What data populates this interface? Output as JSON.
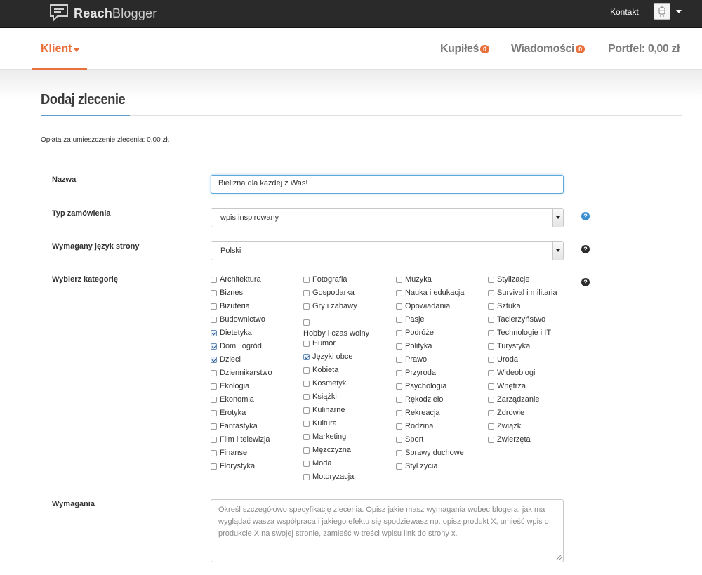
{
  "header": {
    "brand_bold": "Reach",
    "brand_light": "Blogger",
    "contact": "Kontakt"
  },
  "subnav": {
    "role": "Klient",
    "bought_label": "Kupiłeś",
    "bought_count": "0",
    "messages_label": "Wiadomości",
    "messages_count": "0",
    "wallet": "Portfel: 0,00 zł"
  },
  "page": {
    "title": "Dodaj zlecenie",
    "fee": "Opłata za umieszczenie zlecenia: 0,00 zł."
  },
  "form": {
    "name_label": "Nazwa",
    "name_value": "Bielizna dla każdej z Was!",
    "order_type_label": "Typ zamówienia",
    "order_type_value": "wpis inspirowany",
    "language_label": "Wymagany język strony",
    "language_value": "Polski",
    "category_label": "Wybierz kategorię",
    "requirements_label": "Wymagania",
    "requirements_placeholder": "Określ szczegółowo specyfikację zlecenia. Opisz jakie masz wymagania wobec blogera, jak ma wyglądać wasza współpraca i jakiego efektu się spodziewasz np. opisz produkt X, umieść wpis o produkcie X na swojej stronie, zamieść w treści wpisu link do strony x.",
    "help_glyph": "?"
  },
  "categories": [
    [
      {
        "label": "Architektura",
        "checked": false
      },
      {
        "label": "Biznes",
        "checked": false
      },
      {
        "label": "Biżuteria",
        "checked": false
      },
      {
        "label": "Budownictwo",
        "checked": false
      },
      {
        "label": "Dietetyka",
        "checked": true
      },
      {
        "label": "Dom i ogród",
        "checked": true
      },
      {
        "label": "Dzieci",
        "checked": true
      },
      {
        "label": "Dziennikarstwo",
        "checked": false
      },
      {
        "label": "Ekologia",
        "checked": false
      },
      {
        "label": "Ekonomia",
        "checked": false
      },
      {
        "label": "Erotyka",
        "checked": false
      },
      {
        "label": "Fantastyka",
        "checked": false
      },
      {
        "label": "Film i telewizja",
        "checked": false
      },
      {
        "label": "Finanse",
        "checked": false
      },
      {
        "label": "Florystyka",
        "checked": false
      }
    ],
    [
      {
        "label": "Fotografia",
        "checked": false
      },
      {
        "label": "Gospodarka",
        "checked": false
      },
      {
        "label": "Gry i zabawy",
        "checked": false
      },
      {
        "label": "Hobby i czas wolny",
        "checked": false
      },
      {
        "label": "Humor",
        "checked": false
      },
      {
        "label": "Języki obce",
        "checked": true
      },
      {
        "label": "Kobieta",
        "checked": false
      },
      {
        "label": "Kosmetyki",
        "checked": false
      },
      {
        "label": "Książki",
        "checked": false
      },
      {
        "label": "Kulinarne",
        "checked": false
      },
      {
        "label": "Kultura",
        "checked": false
      },
      {
        "label": "Marketing",
        "checked": false
      },
      {
        "label": "Mężczyzna",
        "checked": false
      },
      {
        "label": "Moda",
        "checked": false
      },
      {
        "label": "Motoryzacja",
        "checked": false
      }
    ],
    [
      {
        "label": "Muzyka",
        "checked": false
      },
      {
        "label": "Nauka i edukacja",
        "checked": false
      },
      {
        "label": "Opowiadania",
        "checked": false
      },
      {
        "label": "Pasje",
        "checked": false
      },
      {
        "label": "Podróże",
        "checked": false
      },
      {
        "label": "Polityka",
        "checked": false
      },
      {
        "label": "Prawo",
        "checked": false
      },
      {
        "label": "Przyroda",
        "checked": false
      },
      {
        "label": "Psychologia",
        "checked": false
      },
      {
        "label": "Rękodzieło",
        "checked": false
      },
      {
        "label": "Rekreacja",
        "checked": false
      },
      {
        "label": "Rodzina",
        "checked": false
      },
      {
        "label": "Sport",
        "checked": false
      },
      {
        "label": "Sprawy duchowe",
        "checked": false
      },
      {
        "label": "Styl życia",
        "checked": false
      }
    ],
    [
      {
        "label": "Stylizacje",
        "checked": false
      },
      {
        "label": "Survival i militaria",
        "checked": false
      },
      {
        "label": "Sztuka",
        "checked": false
      },
      {
        "label": "Tacierzyństwo",
        "checked": false
      },
      {
        "label": "Technologie i IT",
        "checked": false
      },
      {
        "label": "Turystyka",
        "checked": false
      },
      {
        "label": "Uroda",
        "checked": false
      },
      {
        "label": "Wideoblogi",
        "checked": false
      },
      {
        "label": "Wnętrza",
        "checked": false
      },
      {
        "label": "Zarządzanie",
        "checked": false
      },
      {
        "label": "Zdrowie",
        "checked": false
      },
      {
        "label": "Związki",
        "checked": false
      },
      {
        "label": "Zwierzęta",
        "checked": false
      }
    ]
  ],
  "colors": {
    "accent": "#e8703a",
    "topbar": "#2a2a2a",
    "focus": "#5fa8dc"
  }
}
